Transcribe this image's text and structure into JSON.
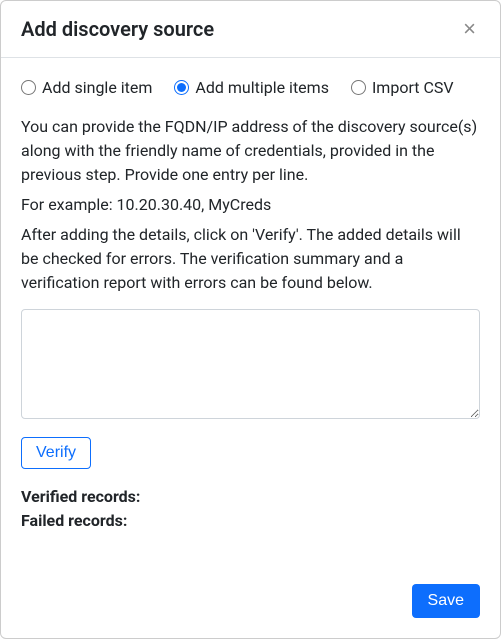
{
  "header": {
    "title": "Add discovery source",
    "close_icon": "×"
  },
  "mode": {
    "single": {
      "label": "Add single item",
      "checked": false
    },
    "multiple": {
      "label": "Add multiple items",
      "checked": true
    },
    "import": {
      "label": "Import CSV",
      "checked": false
    }
  },
  "help": {
    "para1": "You can provide the FQDN/IP address of the discovery source(s) along with the friendly name of credentials, provided in the previous step. Provide one entry per line.",
    "example": "For example: 10.20.30.40, MyCreds",
    "para2": "After adding the details, click on 'Verify'. The added details will be checked for errors. The verification summary and a verification report with errors can be found below."
  },
  "input": {
    "textarea_value": ""
  },
  "actions": {
    "verify_label": "Verify",
    "save_label": "Save"
  },
  "summary": {
    "verified_label": "Verified records:",
    "verified_value": "",
    "failed_label": "Failed records:",
    "failed_value": ""
  }
}
